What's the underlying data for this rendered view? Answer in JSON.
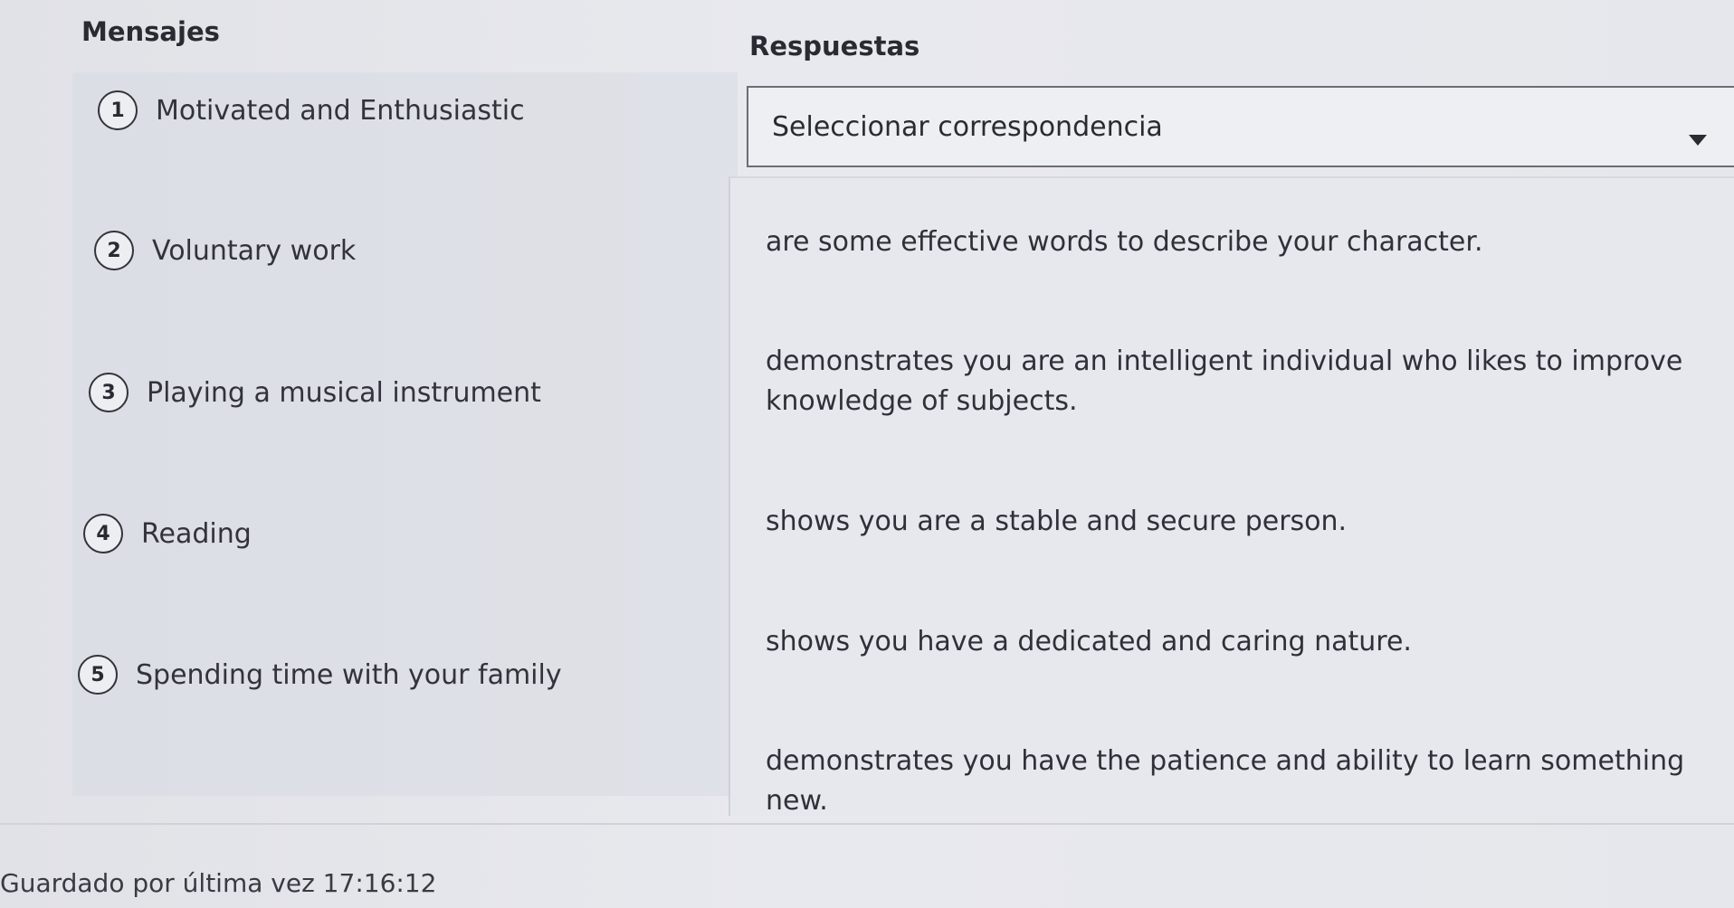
{
  "messages_header": "Mensajes",
  "answers_header": "Respuestas",
  "messages": [
    {
      "number": "1",
      "label": "Motivated and Enthusiastic"
    },
    {
      "number": "2",
      "label": "Voluntary work"
    },
    {
      "number": "3",
      "label": "Playing a musical instrument"
    },
    {
      "number": "4",
      "label": "Reading"
    },
    {
      "number": "5",
      "label": "Spending time with your family"
    }
  ],
  "select": {
    "placeholder": "Seleccionar correspondencia"
  },
  "answers": [
    "are some effective words to describe your character.",
    "demonstrates you are an intelligent individual who likes to improve knowledge of subjects.",
    "shows you are a stable and secure person.",
    "shows you have a dedicated and caring nature.",
    "demonstrates you have the patience and ability to learn something new."
  ],
  "status": {
    "saved_text": "Guardado por última vez 17:16:12"
  }
}
